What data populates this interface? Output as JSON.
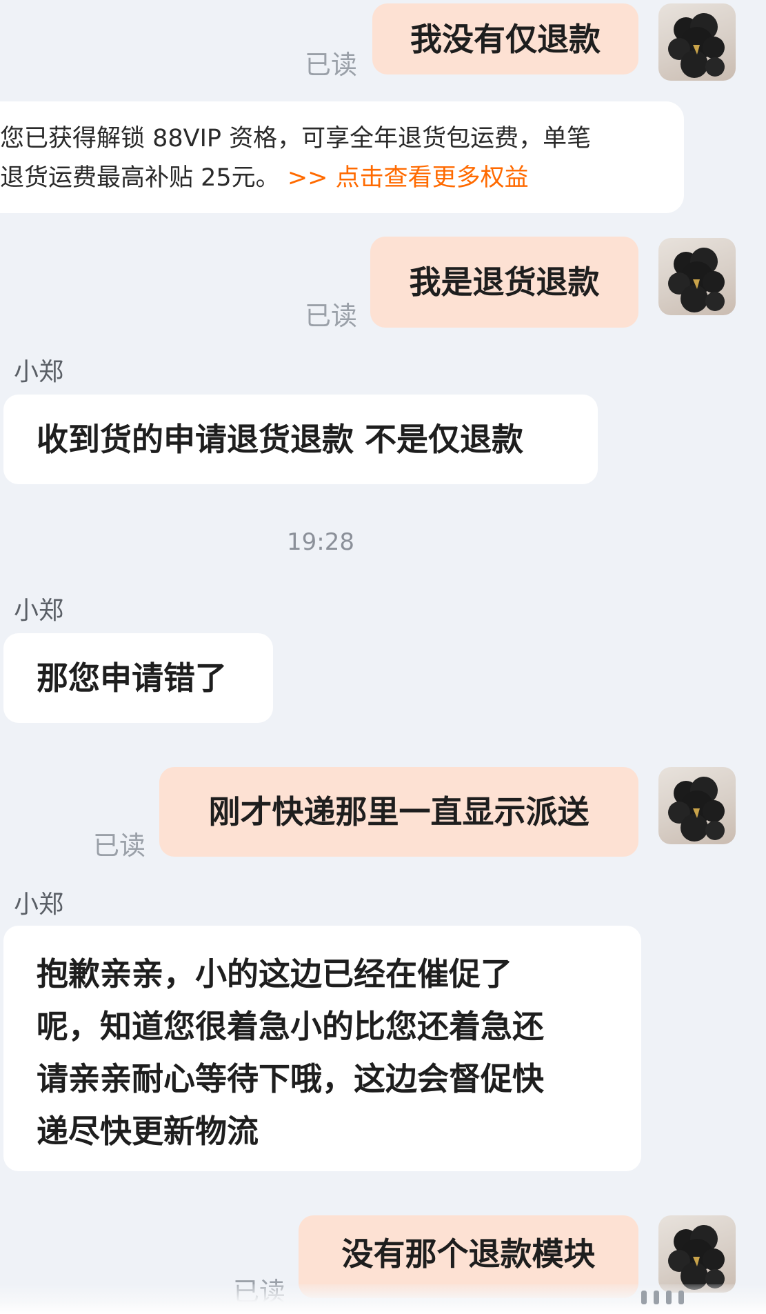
{
  "messages": [
    {
      "kind": "outgoing",
      "text": "我没有仅退款",
      "status": "已读"
    },
    {
      "kind": "promo",
      "line1": "您已获得解锁 88VIP 资格，可享全年退货包运费，单笔",
      "line2": "退货运费最高补贴 25元。",
      "link": ">> 点击查看更多权益"
    },
    {
      "kind": "outgoing",
      "text": "我是退货退款",
      "status": "已读"
    },
    {
      "kind": "incoming",
      "sender": "小郑",
      "text": "收到货的申请退货退款 不是仅退款"
    },
    {
      "kind": "timestamp",
      "text": "19:28"
    },
    {
      "kind": "incoming",
      "sender": "小郑",
      "text": "那您申请错了"
    },
    {
      "kind": "outgoing",
      "text": "刚才快递那里一直显示派送",
      "status": "已读"
    },
    {
      "kind": "incoming",
      "sender": "小郑",
      "lines": [
        "抱歉亲亲，小的这边已经在催促了",
        "呢，知道您很着急小的比您还着急还",
        "请亲亲耐心等待下哦，这边会督促快",
        "递尽快更新物流"
      ]
    },
    {
      "kind": "outgoing",
      "text": "没有那个退款模块",
      "status": "已读"
    }
  ],
  "colors": {
    "background": "#eff2f7",
    "outgoing_bubble": "#fde1d3",
    "incoming_bubble": "#ffffff",
    "link_accent": "#ff6a00",
    "read_status": "#9aa0a8"
  },
  "icons": {
    "avatar": "poodle-avatar-icon"
  }
}
